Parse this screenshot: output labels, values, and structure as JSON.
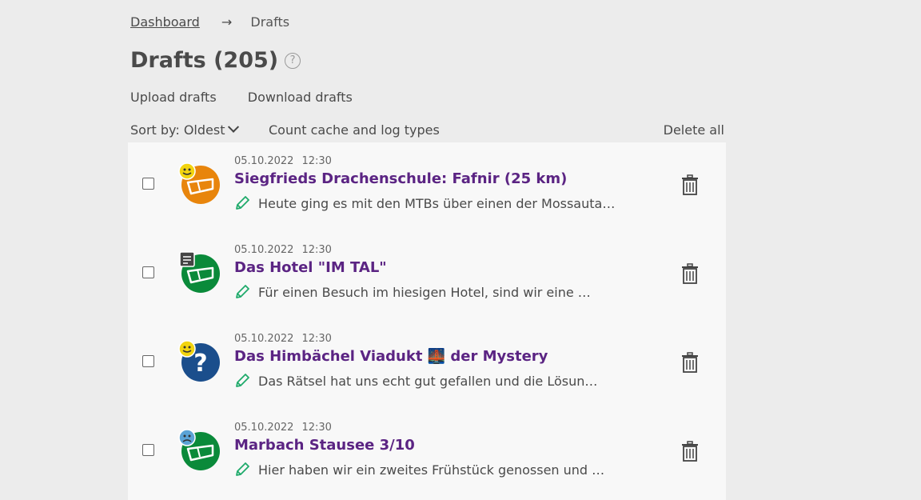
{
  "breadcrumb": {
    "root": "Dashboard",
    "arrow": "→",
    "current": "Drafts"
  },
  "page": {
    "title": "Drafts (205)",
    "help_icon": "?"
  },
  "actions": {
    "upload": "Upload drafts",
    "download": "Download drafts"
  },
  "toolbar": {
    "sort": "Sort by: Oldest",
    "count": "Count cache and log types",
    "delete_all": "Delete all"
  },
  "drafts": [
    {
      "date": "05.10.2022",
      "time": "12:30",
      "title": "Siegfrieds Drachenschule: Fafnir (25 km)",
      "snippet": "Heute ging es mit den MTBs über einen der Mossauta…",
      "cache_type": "traditional",
      "cache_color": "#e8850c",
      "log_type": "found"
    },
    {
      "date": "05.10.2022",
      "time": "12:30",
      "title": "Das Hotel \"IM TAL\"",
      "snippet": "Für einen Besuch im hiesigen Hotel, sind wir eine …",
      "cache_type": "traditional",
      "cache_color": "#0a8a3a",
      "log_type": "note"
    },
    {
      "date": "05.10.2022",
      "time": "12:30",
      "title": "Das Himbächel Viadukt 🌉 der Mystery",
      "snippet": "Das Rätsel hat uns echt gut gefallen und die Lösun…",
      "cache_type": "mystery",
      "cache_color": "#1b4e8c",
      "log_type": "found"
    },
    {
      "date": "05.10.2022",
      "time": "12:30",
      "title": "Marbach Stausee 3/10",
      "snippet": "Hier haben wir ein zweites Frühstück genossen und …",
      "cache_type": "traditional",
      "cache_color": "#0a8a3a",
      "log_type": "did-not-find"
    }
  ],
  "colors": {
    "title": "#5b2483",
    "pencil": "#1faa6b",
    "found": "#f2d40f",
    "dnf": "#5ba3d6"
  }
}
